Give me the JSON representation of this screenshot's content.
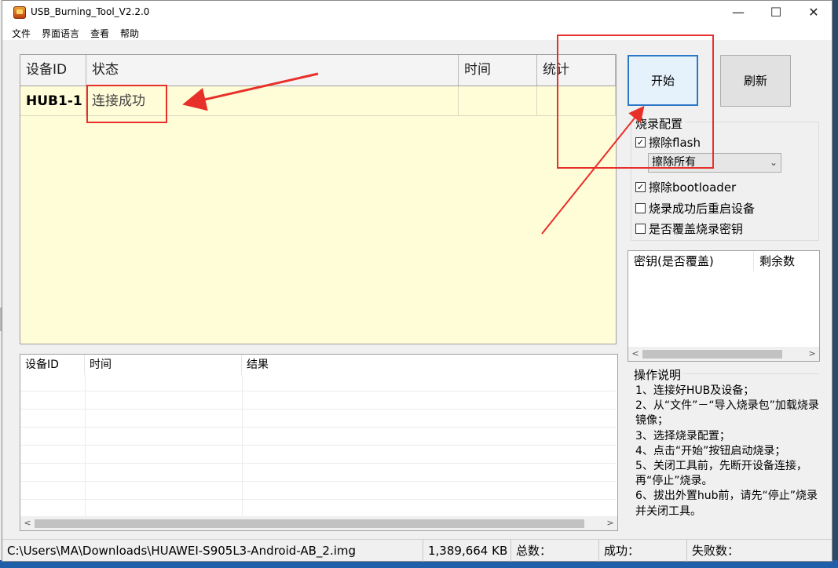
{
  "window": {
    "title": "USB_Burning_Tool_V2.2.0",
    "minimize_icon": "minimize-icon",
    "maximize_icon": "maximize-icon",
    "close_icon": "close-icon",
    "minimize_glyph": "—",
    "maximize_glyph": "☐",
    "close_glyph": "✕"
  },
  "menu": [
    "文件",
    "界面语言",
    "查看",
    "帮助"
  ],
  "device_table": {
    "headers": [
      "设备ID",
      "状态",
      "时间",
      "统计"
    ],
    "rows": [
      {
        "id": "HUB1-1",
        "status": "连接成功",
        "time": "",
        "stat": ""
      }
    ]
  },
  "log_table": {
    "headers": [
      "设备ID",
      "时间",
      "结果"
    ],
    "scroll_left": "<",
    "scroll_right": ">"
  },
  "buttons": {
    "start": "开始",
    "refresh": "刷新"
  },
  "burn_config": {
    "title": "烧录配置",
    "erase_flash": {
      "label": "擦除flash",
      "checked": true
    },
    "erase_mode": "擦除所有",
    "erase_bootloader": {
      "label": "擦除bootloader",
      "checked": true
    },
    "reboot_after": {
      "label": "烧录成功后重启设备",
      "checked": false
    },
    "overwrite_key": {
      "label": "是否覆盖烧录密钥",
      "checked": false
    }
  },
  "key_list": {
    "headers": [
      "密钥(是否覆盖)",
      "剩余数"
    ],
    "scroll_left": "<",
    "scroll_right": ">"
  },
  "instructions": {
    "title": "操作说明",
    "lines": [
      "1、连接好HUB及设备；",
      "2、从“文件”－“导入烧录包”加载烧录镜像；",
      "3、选择烧录配置；",
      "4、点击“开始”按钮启动烧录；",
      "5、关闭工具前，先断开设备连接，再“停止”烧录。",
      "6、拔出外置hub前，请先“停止”烧录并关闭工具。"
    ]
  },
  "status_bar": {
    "path": "C:\\Users\\MA\\Downloads\\HUAWEI-S905L3-Android-AB_2.img",
    "size": "1,389,664 KB",
    "total": "总数：",
    "success": "成功：",
    "fail": "失败数："
  },
  "annotation_color": "#e8302a"
}
